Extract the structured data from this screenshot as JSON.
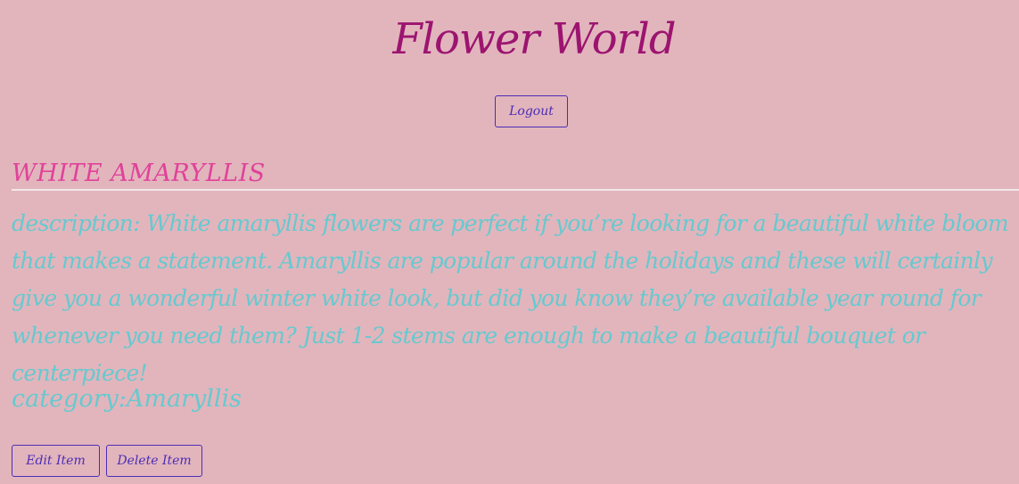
{
  "header": {
    "title": "Flower World",
    "logout_label": "Logout"
  },
  "item": {
    "name": "WHITE AMARYLLIS",
    "description": "description: White amaryllis flowers are perfect if you’re looking for a beautiful white bloom that makes a statement. Amaryllis are popular around the holidays and these will certainly give you a wonderful winter white look, but did you know they’re available year round for whenever you need them? Just 1-2 stems are enough to make a beautiful bouquet or centerpiece!",
    "category": "category:Amaryllis"
  },
  "actions": {
    "edit_label": "Edit Item",
    "delete_label": "Delete Item"
  },
  "colors": {
    "background": "#e2b5bd",
    "title": "#9c1470",
    "item_name": "#e0429a",
    "body_text": "#66c9cf",
    "button": "#4b2db5"
  }
}
